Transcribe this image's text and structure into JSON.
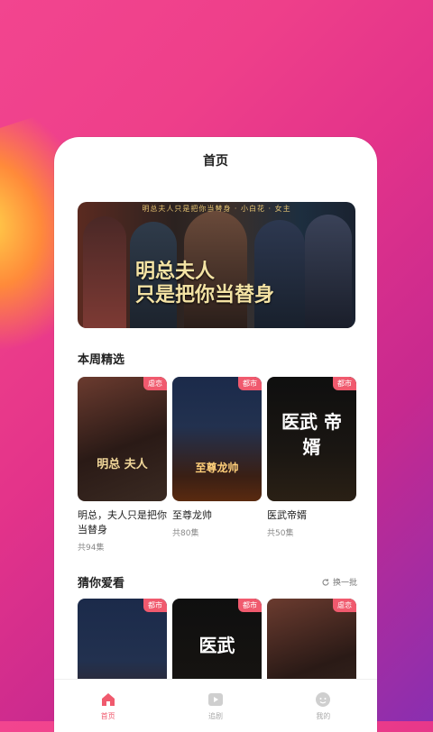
{
  "header": {
    "title": "首页"
  },
  "banner": {
    "tagline": "明总夫人只是把你当替身 · 小白花 · 女主",
    "title_line1": "明总夫人",
    "title_line2": "只是把你当替身"
  },
  "weekly": {
    "title": "本周精选",
    "items": [
      {
        "name": "明总，夫人只是把你当替身",
        "tag": "虐恋",
        "meta": "共94集",
        "cover_art": "明总 夫人"
      },
      {
        "name": "至尊龙帅",
        "tag": "都市",
        "meta": "共80集",
        "cover_art": "至尊龙帅"
      },
      {
        "name": "医武帝婿",
        "tag": "都市",
        "meta": "共50集",
        "cover_art": "医武 帝婿"
      }
    ]
  },
  "guess": {
    "title": "猜你爱看",
    "refresh_label": "换一批",
    "items": [
      {
        "tag": "都市",
        "cover_art": ""
      },
      {
        "tag": "都市",
        "cover_art": "医武"
      },
      {
        "tag": "虐恋",
        "cover_art": ""
      }
    ]
  },
  "tabbar": {
    "items": [
      {
        "label": "首页",
        "icon": "home-icon",
        "active": true
      },
      {
        "label": "追剧",
        "icon": "play-icon",
        "active": false
      },
      {
        "label": "我的",
        "icon": "profile-icon",
        "active": false
      }
    ]
  },
  "colors": {
    "accent": "#f05a6e",
    "bg_start": "#f2458f",
    "bg_end": "#8a2fb0"
  }
}
